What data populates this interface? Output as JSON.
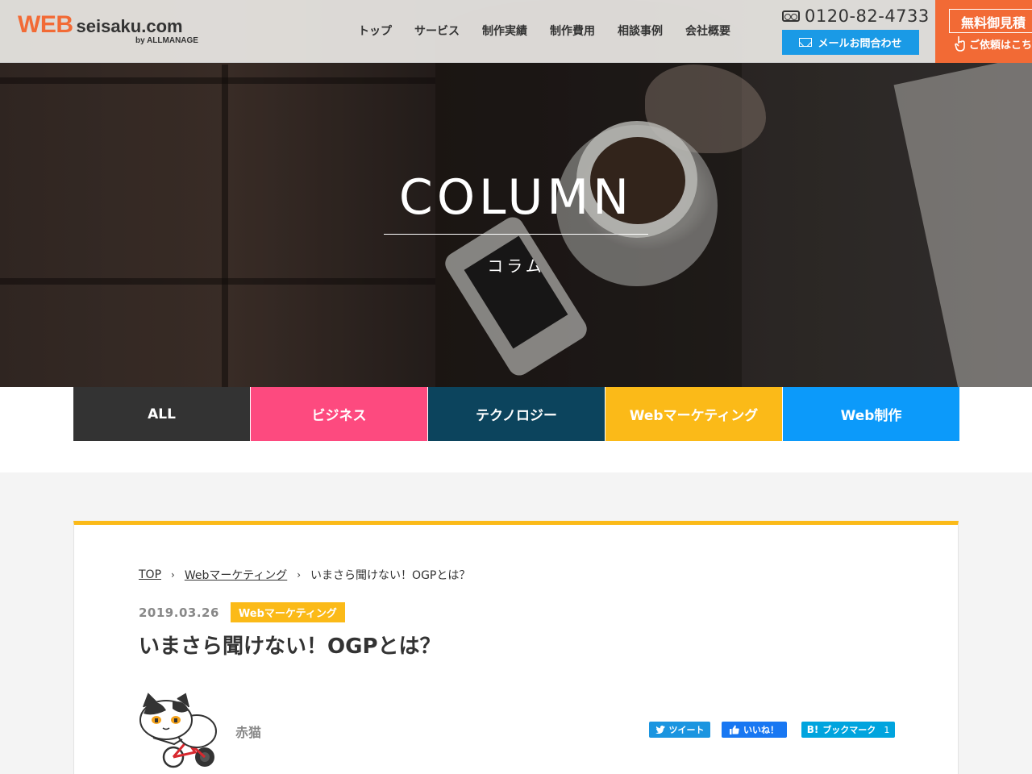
{
  "header": {
    "logo_web": "WEB",
    "logo_site": "seisaku.com",
    "logo_by": "by ALLMANAGE",
    "nav": [
      "トップ",
      "サービス",
      "制作実績",
      "制作費用",
      "相談事例",
      "会社概要"
    ],
    "phone": "0120-82-4733",
    "mail_label": "メールお問合わせ",
    "estimate_label": "無料御見積",
    "estimate_sub": "ご依頼はこち"
  },
  "hero": {
    "title": "COLUMN",
    "subtitle": "コラム"
  },
  "tabs": [
    {
      "label": "ALL",
      "color": "#333333"
    },
    {
      "label": "ビジネス",
      "color": "#fd4a7f"
    },
    {
      "label": "テクノロジー",
      "color": "#0c445d"
    },
    {
      "label": "Webマーケティング",
      "color": "#fbba18"
    },
    {
      "label": "Web制作",
      "color": "#0c9afa"
    }
  ],
  "breadcrumb": {
    "top": "TOP",
    "category": "Webマーケティング",
    "current": "いまさら聞けない！OGPとは？"
  },
  "article": {
    "date": "2019.03.26",
    "category": "Webマーケティング",
    "title": "いまさら聞けない！OGPとは？",
    "author": "赤猫"
  },
  "share": {
    "tweet": "ツイート",
    "like": "いいね！",
    "hatena": "ブックマーク",
    "hatena_count": "1"
  }
}
